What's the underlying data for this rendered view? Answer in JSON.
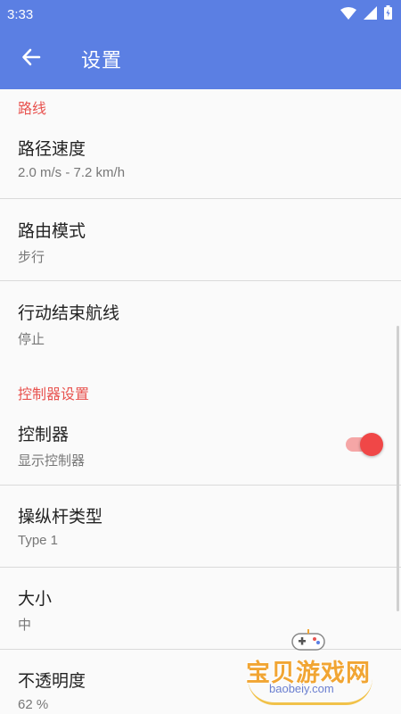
{
  "status_bar": {
    "time": "3:33",
    "icons": [
      "wifi-icon",
      "signal-icon",
      "battery-icon"
    ]
  },
  "app_bar": {
    "title": "设置",
    "back_icon": "arrow-left-icon"
  },
  "sections": {
    "route": {
      "header": "路线",
      "items": [
        {
          "title": "路径速度",
          "summary": "2.0 m/s - 7.2 km/h"
        },
        {
          "title": "路由模式",
          "summary": "步行"
        },
        {
          "title": "行动结束航线",
          "summary": "停止"
        }
      ]
    },
    "controller": {
      "header": "控制器设置",
      "items": [
        {
          "title": "控制器",
          "summary": "显示控制器",
          "switch_on": true
        },
        {
          "title": "操纵杆类型",
          "summary": "Type 1"
        },
        {
          "title": "大小",
          "summary": "中"
        },
        {
          "title": "不透明度",
          "summary": "62 %"
        }
      ]
    }
  },
  "watermark": {
    "text": "宝贝游戏网",
    "url": "baobeiy.com"
  },
  "colors": {
    "primary": "#5b7fe3",
    "accent": "#e8534f",
    "switch_thumb": "#f04747",
    "switch_track": "#f5a6a6"
  }
}
